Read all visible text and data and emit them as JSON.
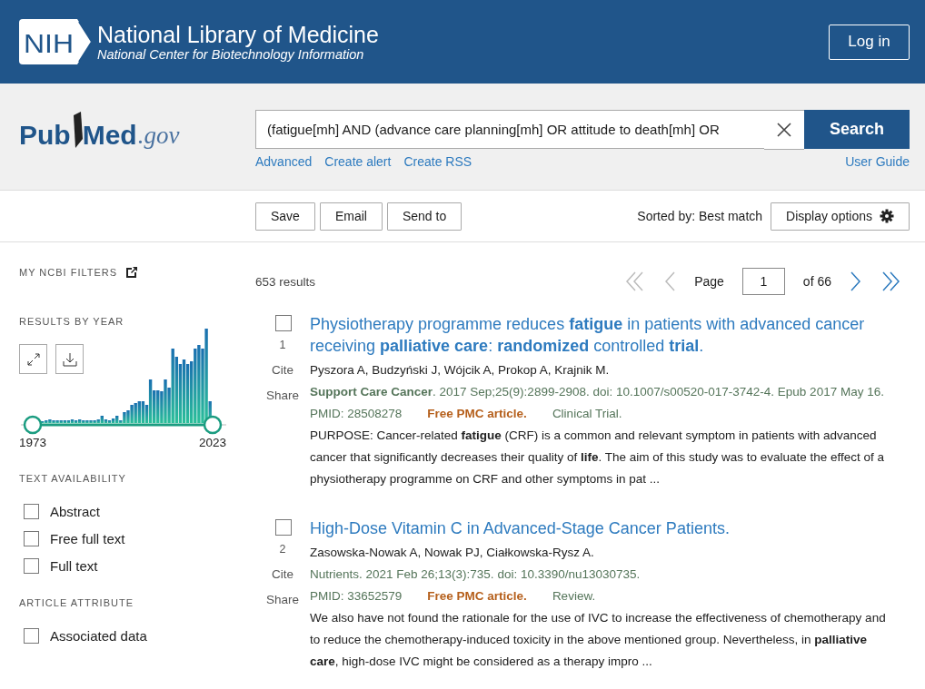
{
  "header": {
    "logo": "NIH",
    "org_title": "National Library of Medicine",
    "org_subtitle": "National Center for Biotechnology Information",
    "login": "Log in"
  },
  "search": {
    "logo_main": "Pub",
    "logo_med": "Med",
    "logo_suffix": ".gov",
    "value": "(fatigue[mh] AND (advance care planning[mh] OR attitude to death[mh] OR ",
    "button": "Search",
    "links": [
      "Advanced",
      "Create alert",
      "Create RSS"
    ],
    "user_guide": "User Guide"
  },
  "toolbar": {
    "buttons": [
      "Save",
      "Email",
      "Send to"
    ],
    "sorted_by": "Sorted by: Best match",
    "display_options": "Display options"
  },
  "sidebar": {
    "my_filters": "MY NCBI FILTERS",
    "results_by_year": "RESULTS BY YEAR",
    "year_start": "1973",
    "year_end": "2023",
    "sections": [
      {
        "title": "TEXT AVAILABILITY",
        "items": [
          {
            "label": "Abstract",
            "checked": false
          },
          {
            "label": "Free full text",
            "checked": false
          },
          {
            "label": "Full text",
            "checked": false
          }
        ]
      },
      {
        "title": "ARTICLE ATTRIBUTE",
        "items": [
          {
            "label": "Associated data",
            "checked": false
          }
        ]
      }
    ]
  },
  "results": {
    "count": "653 results",
    "pagination": {
      "page_label": "Page",
      "page": "1",
      "of": "of 66",
      "first_disabled": true,
      "prev_disabled": true,
      "next_disabled": false,
      "last_disabled": false
    },
    "items": [
      {
        "checked": false,
        "number": "1",
        "cite": "Cite",
        "share": "Share",
        "title": "Physiotherapy programme reduces **fatigue** in patients with advanced cancer receiving **palliative care**: **randomized** controlled **trial**.",
        "authors": "Pyszora A, Budzyński J, Wójcik A, Prokop A, Krajnik M.",
        "citation": "**Support Care Cancer**. 2017 Sep;25(9):2899-2908. doi: 10.1007/s00520-017-3742-4. Epub 2017 May 16.",
        "pmid": "PMID: 28508278",
        "free": "Free PMC article.",
        "type": "Clinical Trial.",
        "snippet": "PURPOSE: Cancer-related **fatigue** (CRF) is a common and relevant symptom in patients with advanced cancer that significantly decreases their quality of **life**. The aim of this study was to evaluate the effect of a physiotherapy programme on CRF and other symptoms in pat ..."
      },
      {
        "checked": false,
        "number": "2",
        "cite": "Cite",
        "share": "Share",
        "title": "High-Dose Vitamin C in Advanced-Stage Cancer Patients.",
        "authors": "Zasowska-Nowak A, Nowak PJ, Ciałkowska-Rysz A.",
        "citation": "Nutrients. 2021 Feb 26;13(3):735. doi: 10.3390/nu13030735.",
        "pmid": "PMID: 33652579",
        "free": "Free PMC article.",
        "type": "Review.",
        "snippet": "We also have not found the rationale for the use of IVC to increase the effectiveness of chemotherapy and to reduce the chemotherapy-induced toxicity in the above mentioned group. Nevertheless, in **palliative care**, high-dose IVC might be considered as a therapy impro ..."
      }
    ]
  }
}
